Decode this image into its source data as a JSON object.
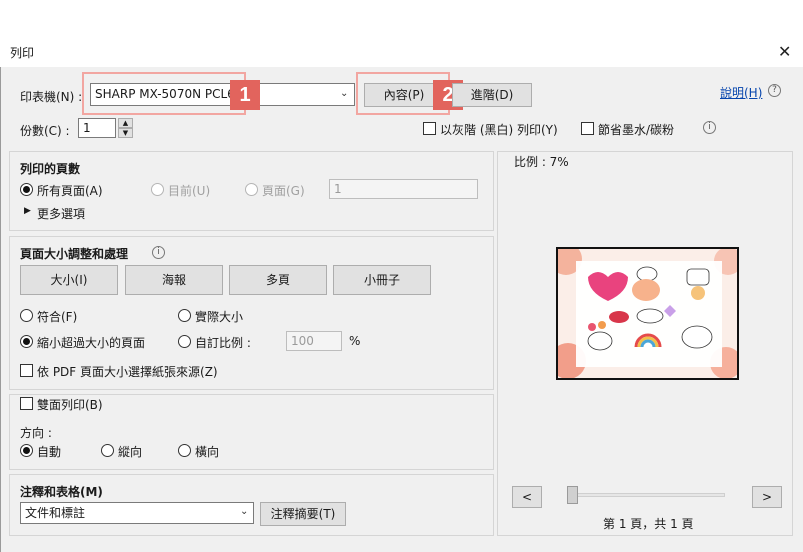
{
  "window": {
    "title": "列印"
  },
  "printer": {
    "label": "印表機(N) :",
    "value": "SHARP MX-5070N PCL6",
    "properties_button": "內容(P)",
    "advanced_button": "進階(D)",
    "help_link": "說明(H)",
    "help_icon": "?"
  },
  "callouts": {
    "one": "1",
    "two": "2"
  },
  "copies": {
    "label": "份數(C) :",
    "value": "1"
  },
  "options": {
    "grayscale": "以灰階 (黑白) 列印(Y)",
    "save_ink": "節省墨水/碳粉",
    "info_icon": "i"
  },
  "pages_to_print": {
    "title": "列印的頁數",
    "all_pages": "所有頁面(A)",
    "current": "目前(U)",
    "pages": "頁面(G)",
    "pages_value": "1",
    "more_options": "更多選項"
  },
  "page_sizing": {
    "title": "頁面大小調整和處理",
    "info_icon": "i",
    "tabs": [
      "大小(I)",
      "海報",
      "多頁",
      "小冊子"
    ],
    "fit": "符合(F)",
    "actual_size": "實際大小",
    "shrink": "縮小超過大小的頁面",
    "custom_scale": "自訂比例 :",
    "scale_value": "100",
    "percent": "%",
    "pdf_page_size": "依 PDF 頁面大小選擇紙張來源(Z)"
  },
  "duplex": {
    "label": "雙面列印(B)",
    "orientation_label": "方向 :",
    "auto": "自動",
    "portrait": "縱向",
    "landscape": "橫向"
  },
  "comments": {
    "title": "注釋和表格(M)",
    "value": "文件和標註",
    "summarize_button": "注釋摘要(T)"
  },
  "preview": {
    "scale": "比例 :  7%",
    "prev": "<",
    "next": ">",
    "page_info": "第 1 頁，共 1 頁",
    "slider_fraction": 0.0
  }
}
